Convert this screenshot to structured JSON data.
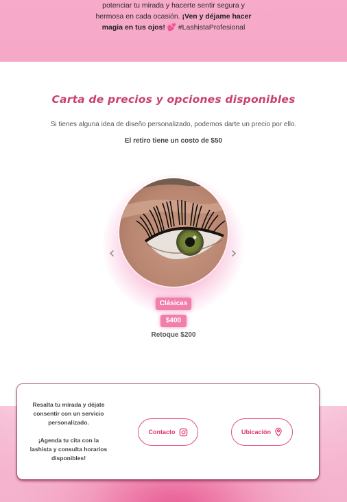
{
  "hero": {
    "line1": "potenciar tu mirada y hacerte sentir segura y",
    "line2_plain": "hermosa en cada ocasión. ",
    "line2_bold": "¡Ven y déjame hacer",
    "line3_bold": "magia en tus ojos!",
    "heart": "💕",
    "hashtag": "#LashistaProfesional"
  },
  "pricing": {
    "title": "Carta de precios y opciones disponibles",
    "subtitle": "Si tienes alguna idea de diseño personalizado, podemos darte un precio por ello.",
    "removal_fee": "El retiro tiene un costo de $50"
  },
  "carousel": {
    "prev_icon": "chevron-left-icon",
    "next_icon": "chevron-right-icon",
    "prev_glyph": "‹",
    "next_glyph": "›",
    "item": {
      "category": "Clásicas",
      "price": "$400",
      "retouch": "Retoque $200"
    }
  },
  "footer_card": {
    "text_p1": "Resalta tu mirada y déjate consentir con un servicio personalizado.",
    "text_p2": "¡Agenda tu cita con la lashista y consulta horarios disponibles!",
    "contact_label": "Contacto",
    "contact_icon": "instagram-icon",
    "location_label": "Ubicación",
    "location_icon": "map-pin-icon"
  },
  "colors": {
    "accent": "#d9336f",
    "pill": "#f07fab",
    "hero_bg": "#f7aac9"
  }
}
